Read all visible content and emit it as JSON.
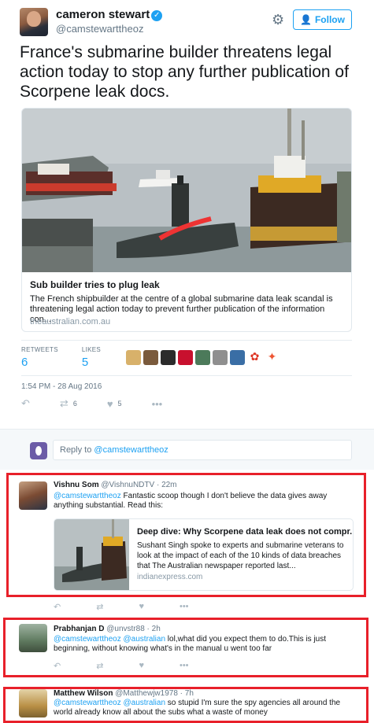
{
  "tweet": {
    "name": "cameron stewart",
    "handle": "@camstewarttheoz",
    "follow_label": "Follow",
    "text": "France's submarine builder threatens legal action today to stop any further publication of Scorpene leak docs.",
    "card": {
      "title": "Sub builder tries to plug leak",
      "description": "The French shipbuilder at the centre of a global submarine data leak scandal is threatening legal action today to prevent further publication of the information con...",
      "domain": "theaustralian.com.au"
    },
    "retweets_label": "RETWEETS",
    "retweets": "6",
    "likes_label": "LIKES",
    "likes": "5",
    "timestamp": "1:54 PM - 28 Aug 2016",
    "action_retweet_count": "6",
    "action_like_count": "5"
  },
  "reply_box": {
    "prefix": "Reply to ",
    "mention": "@camstewarttheoz"
  },
  "replies": [
    {
      "name": "Vishnu Som",
      "handle": "@VishnuNDTV",
      "time": "22m",
      "mention": "@camstewarttheoz",
      "text": " Fantastic scoop though I don't believe the data gives away anything substantial. Read this:",
      "card": {
        "title": "Deep dive: Why Scorpene data leak does not compr...",
        "description": "Sushant Singh spoke to experts and submarine veterans to look at the impact of each of the 10 kinds of data breaches that The Australian newspaper reported last...",
        "domain": "indianexpress.com"
      }
    },
    {
      "name": "Prabhanjan D",
      "handle": "@unvstr88",
      "time": "2h",
      "mention": "@camstewarttheoz @australian",
      "text": " lol,what did you expect them to do.This is just beginning, without knowing what's in the manual u went too far"
    },
    {
      "name": "Matthew Wilson",
      "handle": "@Matthewjw1978",
      "time": "7h",
      "mention": "@camstewarttheoz @australian",
      "text": " so stupid I'm sure the spy agencies all around the world already know all about the subs what a waste of money"
    }
  ],
  "colors": {
    "accent": "#1da1f2",
    "highlight": "#e8202a",
    "muted": "#657786"
  }
}
